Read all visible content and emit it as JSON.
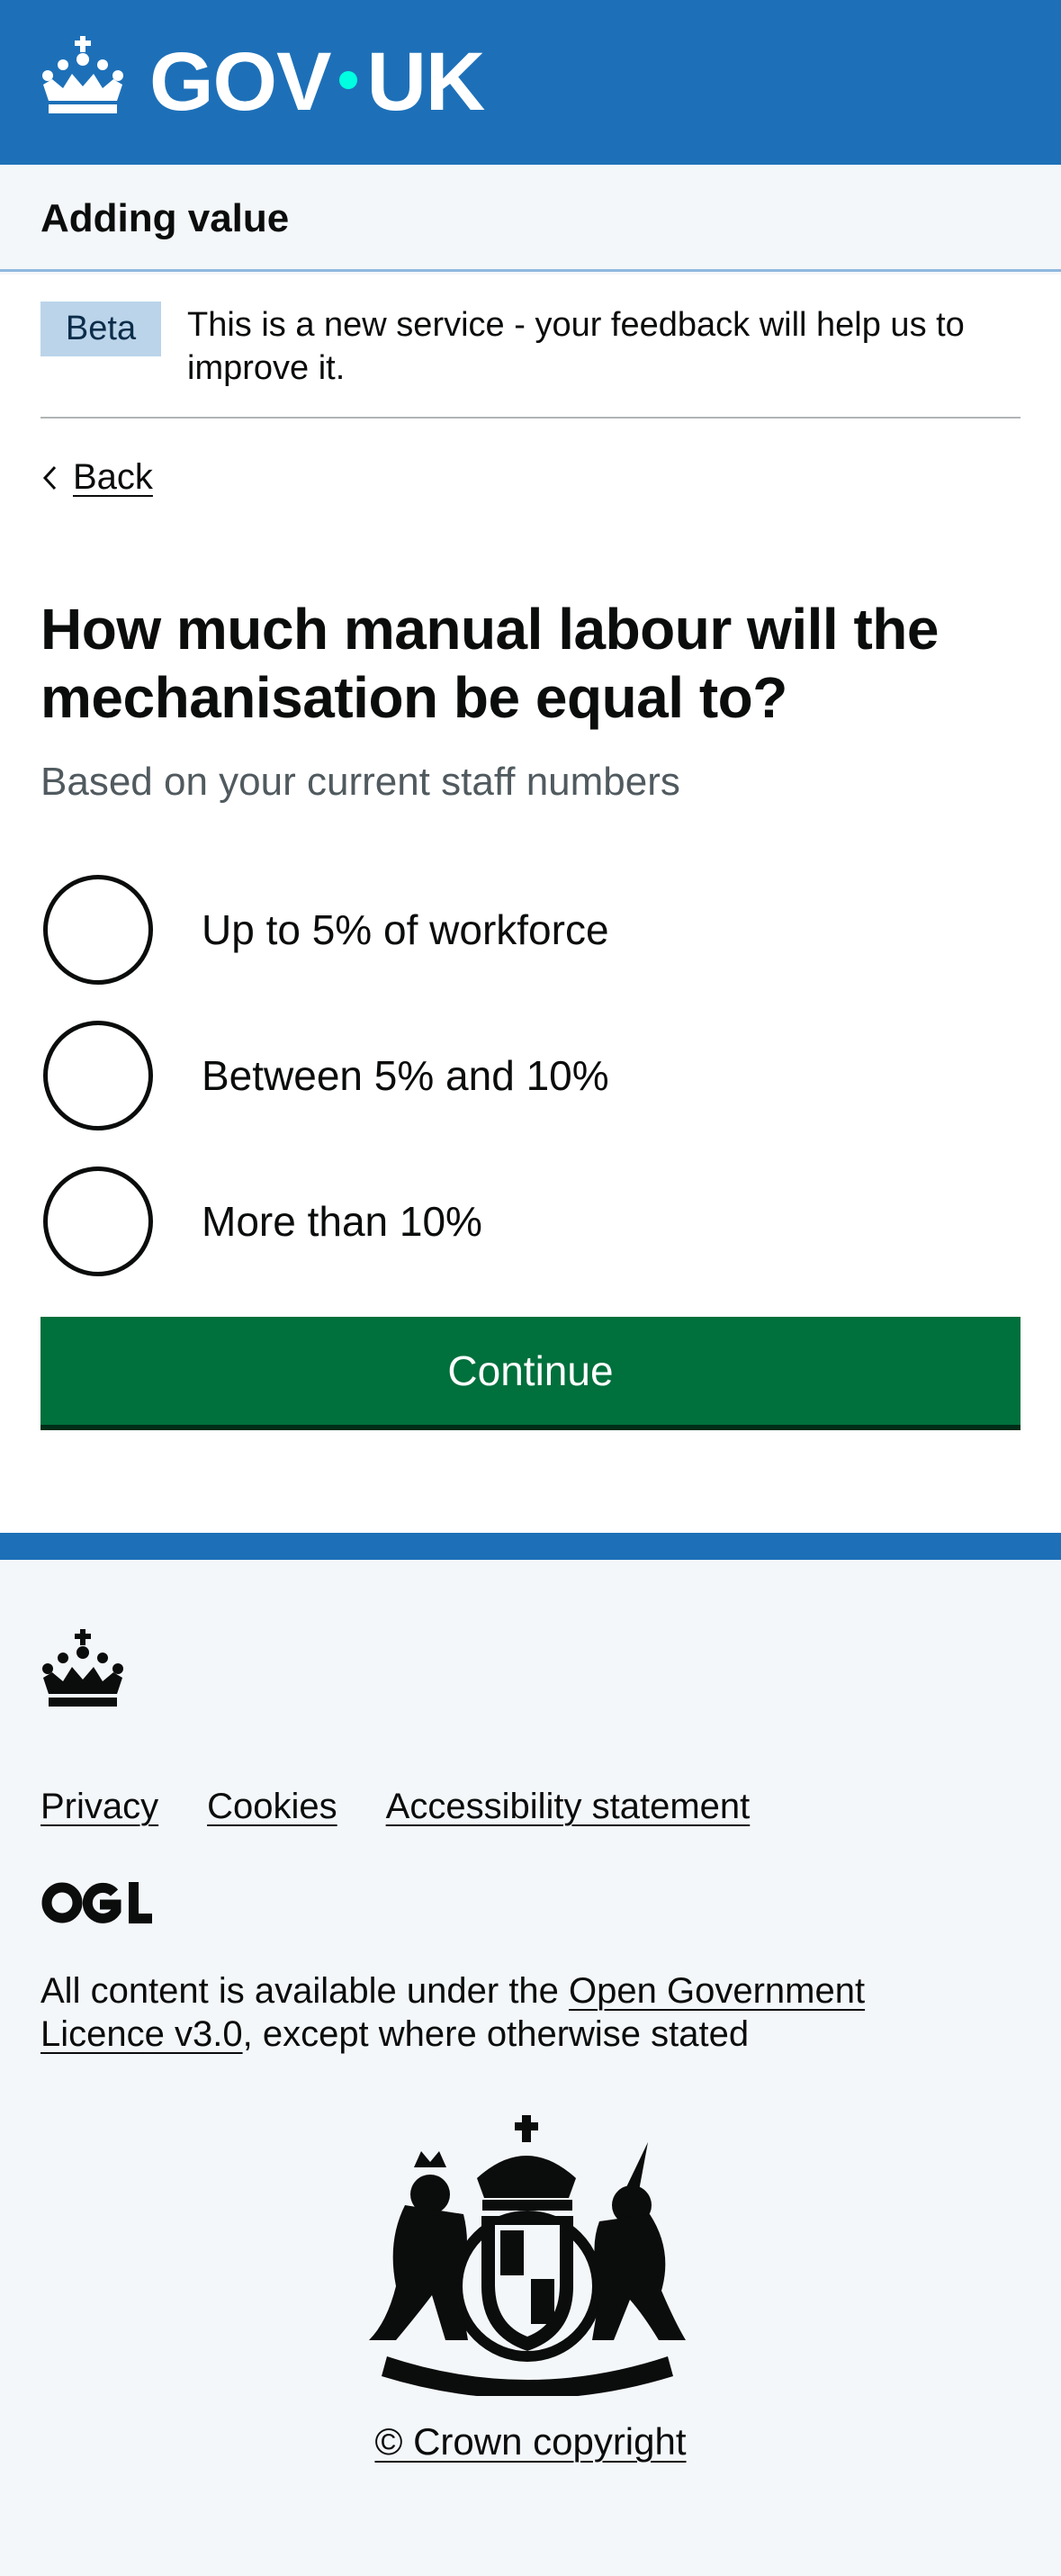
{
  "header": {
    "logo_left": "GOV",
    "logo_right": "UK",
    "logo_icon": "crown-icon"
  },
  "service": {
    "name": "Adding value"
  },
  "phase_banner": {
    "tag": "Beta",
    "text": "This is a new service - your feedback will help us to improve it."
  },
  "back_link": {
    "label": "Back",
    "icon": "chevron-left-icon"
  },
  "question": {
    "title": "How much manual labour will the mechanisation be equal to?",
    "hint": "Based on your current staff numbers",
    "options": [
      {
        "label": "Up to 5% of workforce"
      },
      {
        "label": "Between 5% and 10%"
      },
      {
        "label": "More than 10%"
      }
    ]
  },
  "continue_button": {
    "label": "Continue",
    "color": "#00703c"
  },
  "footer": {
    "links": [
      {
        "label": "Privacy"
      },
      {
        "label": "Cookies"
      },
      {
        "label": "Accessibility statement"
      }
    ],
    "ogl_icon": "ogl-logo-icon",
    "licence_prefix": "All content is available under the ",
    "licence_link": "Open Government Licence v3.0",
    "licence_suffix": ", except where otherwise stated",
    "crest_icon": "royal-coat-of-arms-icon",
    "copyright": "© Crown copyright"
  },
  "colors": {
    "brand_blue": "#1d70b8",
    "text": "#0b0c0c",
    "hint": "#505a5f",
    "footer_bg": "#f3f7f9",
    "beta_tag_bg": "#bbd4ea"
  }
}
